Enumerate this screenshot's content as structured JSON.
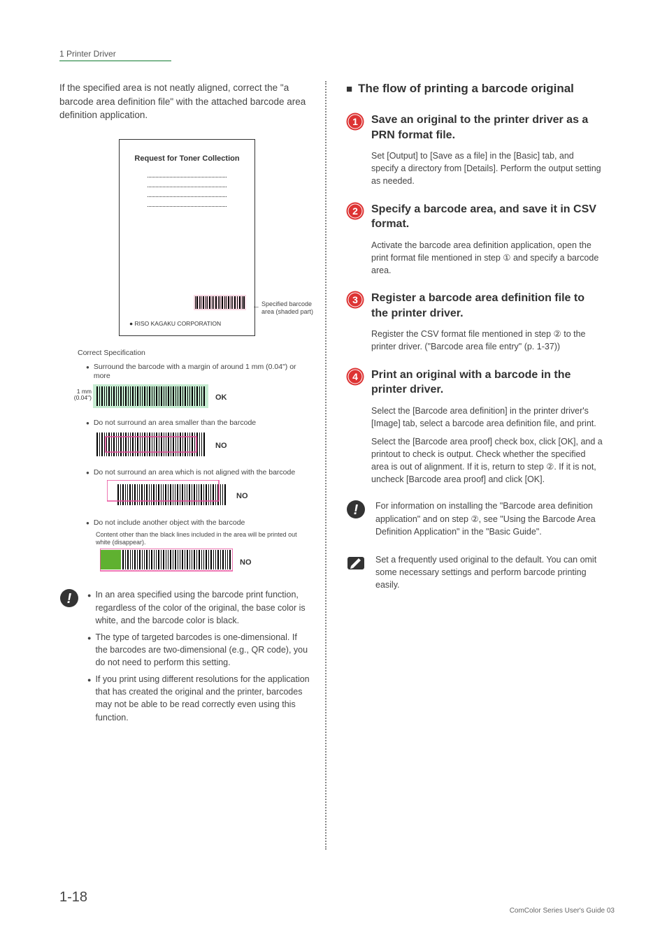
{
  "header": {
    "section": "1 Printer Driver"
  },
  "left": {
    "intro": "If the specified area is not neatly aligned, correct the \"a barcode area definition file\" with the attached barcode area definition application.",
    "sample": {
      "title": "Request for Toner Collection",
      "corp": "RISO KAGAKU CORPORATION",
      "annot": "Specified barcode area (shaded part)"
    },
    "caption": "Correct Specification",
    "spec1": "Surround the barcode with a margin of around 1 mm (0.04\") or more",
    "mm": "1 mm (0.04\")",
    "ok": "OK",
    "spec2": "Do not surround an area smaller than the barcode",
    "no": "NO",
    "spec3": "Do not surround an area which is not aligned with the barcode",
    "spec4": "Do not include another object with the barcode",
    "spec4sub": "Content other than the black lines included in the area will be printed out white (disappear).",
    "notes": [
      "In an area specified using the barcode print function, regardless of the color of the original, the base color is white, and the barcode color is black.",
      "The type of targeted barcodes is one-dimensional. If the barcodes are two-dimensional (e.g., QR code), you do not need to perform this setting.",
      "If you print using different resolutions for the application that has created the original and the printer, barcodes may not be able to be read correctly even using this function."
    ]
  },
  "right": {
    "heading": "The flow of printing a barcode original",
    "steps": [
      {
        "num": "1",
        "title": "Save an original to the printer driver as a PRN format file.",
        "body": "Set [Output] to [Save as a file] in the [Basic] tab, and specify a directory from [Details]. Perform the output setting as needed."
      },
      {
        "num": "2",
        "title": "Specify a barcode area, and save it in CSV format.",
        "body": "Activate the barcode area definition application, open the print format file mentioned in step ① and specify a barcode area."
      },
      {
        "num": "3",
        "title": "Register a barcode area definition file to the printer driver.",
        "body": "Register the CSV format file mentioned in step ② to the printer driver. (\"Barcode area file entry\" (p. 1-37))"
      },
      {
        "num": "4",
        "title": "Print an original with a barcode in the printer driver.",
        "body1": "Select the [Barcode area definition] in the printer driver's [Image] tab, select a barcode area definition file, and print.",
        "body2": "Select the [Barcode area proof] check box, click [OK], and a printout to check is output. Check whether the specified area is out of alignment. If it is, return to step ②. If it is not, uncheck [Barcode area proof] and click [OK]."
      }
    ],
    "caution": "For information on installing the \"Barcode area definition application\" and on step ②, see \"Using the Barcode Area Definition Application\" in the \"Basic Guide\".",
    "tip": "Set a frequently used original to the default. You can omit some necessary settings and perform barcode printing easily."
  },
  "page": "1-18",
  "footer": "ComColor Series User's Guide 03"
}
